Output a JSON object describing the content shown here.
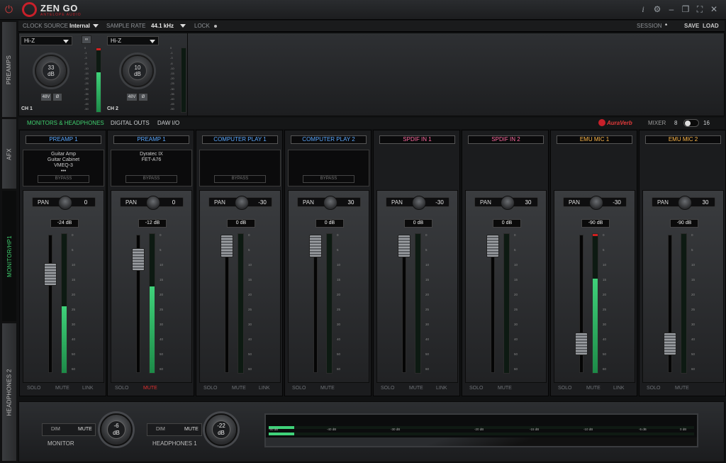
{
  "app": {
    "title": "ZEN GO",
    "subtitle": "ANTELOPE AUDIO"
  },
  "titlebar_icons": [
    "power-icon",
    "info-icon",
    "gear-icon",
    "minimize-icon",
    "restore-icon",
    "fullscreen-icon",
    "close-icon"
  ],
  "left_tabs": [
    "PREAMPS",
    "AFX",
    "MONITOR/HP1",
    "HEADPHONES 2"
  ],
  "topbar": {
    "clock_source_label": "CLOCK SOURCE",
    "clock_source_value": "Internal",
    "sample_rate_label": "SAMPLE RATE",
    "sample_rate_value": "44.1 kHz",
    "lock_label": "LOCK",
    "session_label": "SESSION",
    "session_value": "*",
    "save_label": "SAVE",
    "load_label": "LOAD"
  },
  "preamps": [
    {
      "input": "Hi-Z",
      "gain": "33",
      "unit": "dB",
      "phantom": "48V",
      "phase": "Ø",
      "label": "CH 1",
      "meter_level": 0.62
    },
    {
      "input": "Hi-Z",
      "gain": "10",
      "unit": "dB",
      "phantom": "48V",
      "phase": "Ø",
      "label": "CH 2",
      "meter_level": 0.0
    }
  ],
  "preamp_scale": [
    "0",
    "-1",
    "-3",
    "-6",
    "-10",
    "-15",
    "-20",
    "-25",
    "-30",
    "-35",
    "-40",
    "-45",
    "-50"
  ],
  "subnav": {
    "monitors": "MONITORS & HEADPHONES",
    "digital_outs": "DIGITAL OUTS",
    "daw_io": "DAW I/O",
    "auraverb": "AuraVerb",
    "mixer_label": "MIXER",
    "mixer_a": "8",
    "mixer_b": "16"
  },
  "channels": [
    {
      "name": "PREAMP 1",
      "name_color": "#5aa8ff",
      "fx": [
        "Guitar Amp",
        "Guitar Cabinet",
        "VMEQ-3",
        "•••"
      ],
      "bypass": "BYPASS",
      "pan_label": "PAN",
      "pan": "0",
      "db": "-24 dB",
      "fader": 0.25,
      "meter": 0.48,
      "peak": false,
      "solo": "SOLO",
      "mute": "MUTE",
      "link": "LINK",
      "mute_active": false
    },
    {
      "name": "PREAMP 1",
      "name_color": "#5aa8ff",
      "fx": [
        "Dyratec IX",
        "FET-A76"
      ],
      "bypass": "BYPASS",
      "pan_label": "PAN",
      "pan": "0",
      "db": "-12 dB",
      "fader": 0.12,
      "meter": 0.62,
      "peak": false,
      "solo": "SOLO",
      "mute": "MUTE",
      "link": "",
      "mute_active": true
    },
    {
      "name": "COMPUTER PLAY 1",
      "name_color": "#5aa8ff",
      "fx": [],
      "bypass": "BYPASS",
      "pan_label": "PAN",
      "pan": "-30",
      "db": "0 dB",
      "fader": 0.0,
      "meter": 0.0,
      "peak": false,
      "solo": "SOLO",
      "mute": "MUTE",
      "link": "LINK",
      "mute_active": false
    },
    {
      "name": "COMPUTER PLAY 2",
      "name_color": "#5aa8ff",
      "fx": [],
      "bypass": "BYPASS",
      "pan_label": "PAN",
      "pan": "30",
      "db": "0 dB",
      "fader": 0.0,
      "meter": 0.0,
      "peak": false,
      "solo": "SOLO",
      "mute": "MUTE",
      "link": "",
      "mute_active": false
    },
    {
      "name": "SPDIF IN 1",
      "name_color": "#ff6aa0",
      "fx": null,
      "bypass": "",
      "pan_label": "PAN",
      "pan": "-30",
      "db": "0 dB",
      "fader": 0.0,
      "meter": 0.0,
      "peak": false,
      "solo": "SOLO",
      "mute": "MUTE",
      "link": "LINK",
      "mute_active": false
    },
    {
      "name": "SPDIF IN 2",
      "name_color": "#ff6aa0",
      "fx": null,
      "bypass": "",
      "pan_label": "PAN",
      "pan": "30",
      "db": "0 dB",
      "fader": 0.0,
      "meter": 0.0,
      "peak": false,
      "solo": "SOLO",
      "mute": "MUTE",
      "link": "",
      "mute_active": false
    },
    {
      "name": "EMU MIC 1",
      "name_color": "#ffb84a",
      "fx": null,
      "bypass": "",
      "pan_label": "PAN",
      "pan": "-30",
      "db": "-90 dB",
      "fader": 0.86,
      "meter": 0.68,
      "peak": true,
      "solo": "SOLO",
      "mute": "MUTE",
      "link": "LINK",
      "mute_active": false
    },
    {
      "name": "EMU MIC 2",
      "name_color": "#ffb84a",
      "fx": null,
      "bypass": "",
      "pan_label": "PAN",
      "pan": "30",
      "db": "-90 dB",
      "fader": 0.86,
      "meter": 0.0,
      "peak": false,
      "solo": "SOLO",
      "mute": "MUTE",
      "link": "",
      "mute_active": false
    }
  ],
  "fader_scale": [
    "0",
    "5",
    "10",
    "15",
    "20",
    "25",
    "30",
    "40",
    "50",
    "60"
  ],
  "bottom": {
    "monitor": {
      "dim": "DIM",
      "mute": "MUTE",
      "value": "-6",
      "unit": "dB",
      "label": "MONITOR"
    },
    "headphones": {
      "dim": "DIM",
      "mute": "MUTE",
      "value": "-22",
      "unit": "dB",
      "label": "HEADPHONES 1"
    },
    "spectrum_scale": [
      "-50 dB",
      "-40 dB",
      "-30 dB",
      "-20 dB",
      "-15 dB",
      "-10 dB",
      "-5 dB",
      "0 dB"
    ],
    "spectrum_level": 0.06
  }
}
